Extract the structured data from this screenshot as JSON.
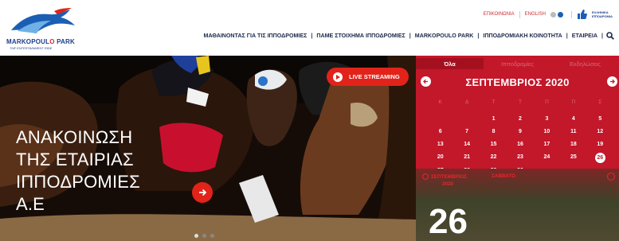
{
  "header": {
    "logo": {
      "title_a": "MARKOPOUL",
      "title_o": "O",
      "title_b": " PARK",
      "tagline": "THE ENTERTAINMENT RIDE"
    },
    "util": {
      "contact": "ΕΠΙΚΟΙΝΩΝΙΑ",
      "language": "ENGLISH",
      "sponsor": "ΕΛΛΗΝΙΚΑ ΙΠΠΟΔΡΟΜΙΑ"
    },
    "nav": [
      "ΜΑΘΑΙΝΟΝΤΑΣ ΓΙΑ ΤΙΣ ΙΠΠΟΔΡΟΜΙΕΣ",
      "ΠΑΜΕ ΣΤΟΙΧΗΜΑ ΙΠΠΟΔΡΟΜΙΕΣ",
      "MARKOPOULO PARK",
      "ΙΠΠΟΔΡΟΜΙΑΚΗ ΚΟΙΝΟΤΗΤΑ",
      "ΕΤΑΙΡΕΙΑ"
    ]
  },
  "hero": {
    "headline_lines": [
      "ΑΝΑΚΟΙΝΩΣΗ",
      "ΤΗΣ ΕΤΑΙΡΙΑΣ",
      "ΙΠΠΟΔΡΟΜΙΕΣ",
      "Α.Ε"
    ],
    "live_label": "LIVE STREAMING",
    "slides": 3,
    "active_slide": 0
  },
  "calendar": {
    "tabs": [
      "Όλα",
      "Ιπποδρομίες",
      "Εκδηλώσεις"
    ],
    "active_tab": 0,
    "month": "ΣΕΠΤΕΜΒΡΙΟΣ 2020",
    "weekdays": [
      "Κ",
      "Δ",
      "Τ",
      "Τ",
      "Π",
      "Π",
      "Σ"
    ],
    "first_weekday_index": 2,
    "days_in_month": 30,
    "today": 26,
    "event": {
      "month": "ΣΕΠΤΕΜΒΡΙΟΣ",
      "year": "2020",
      "weekday": "ΣΑΒΒΑΤΟ",
      "day": "26"
    }
  },
  "colors": {
    "brand_red": "#c3172a",
    "accent_red": "#e2231a",
    "navy": "#1a3e8c"
  }
}
